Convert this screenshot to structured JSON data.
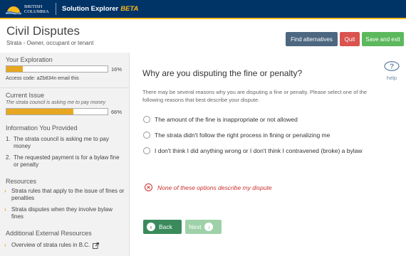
{
  "topbar": {
    "logo_line1": "BRITISH",
    "logo_line2": "COLUMBIA",
    "app_name": "Solution Explorer",
    "beta": "BETA"
  },
  "header": {
    "title": "Civil Disputes",
    "subtitle": "Strata - Owner, occupant or tenant",
    "find_alternatives": "Find alternatives",
    "quit": "Quit",
    "save_exit": "Save and exit"
  },
  "sidebar": {
    "exploration_label": "Your Exploration",
    "exploration_pct": "16%",
    "exploration_progress": 0.16,
    "access_code": "Access code: aZb834n email this",
    "current_issue_label": "Current Issue",
    "current_issue_text": "The strata council is asking me to pay money",
    "issue_pct": "66%",
    "issue_progress": 0.66,
    "info_label": "Information You Provided",
    "info_items": [
      {
        "num": "1.",
        "text": "The strata council is asking me to pay money"
      },
      {
        "num": "2.",
        "text": "The requested payment is for a bylaw fine or penalty"
      }
    ],
    "resources_label": "Resources",
    "resources": [
      "Strata rules that apply to the issue of fines or penalties",
      "Strata disputes when they involve bylaw fines"
    ],
    "external_label": "Additional External Resources",
    "external": [
      "Overview of strata rules in B.C."
    ]
  },
  "main": {
    "question": "Why are you disputing the fine or penalty?",
    "help": "help",
    "intro": "There may be several reasons why you are disputing a fine or penalty. Please select one of the following reasons that best describe your dispute.",
    "options": [
      "The amount of the fine is inappropriate or not allowed",
      "The strata didn't follow the right process in fining or penalizing me",
      "I don't think I did anything wrong or I don't think I contravened (broke) a bylaw"
    ],
    "none_option": "None of these options describe my dispute",
    "back": "Back",
    "next": "Next"
  },
  "colors": {
    "topbar": "#003366",
    "accent": "#fcba19",
    "progress": "#e7a720",
    "quit": "#d9534f",
    "save": "#5cb85c",
    "back": "#3a8a5c"
  }
}
